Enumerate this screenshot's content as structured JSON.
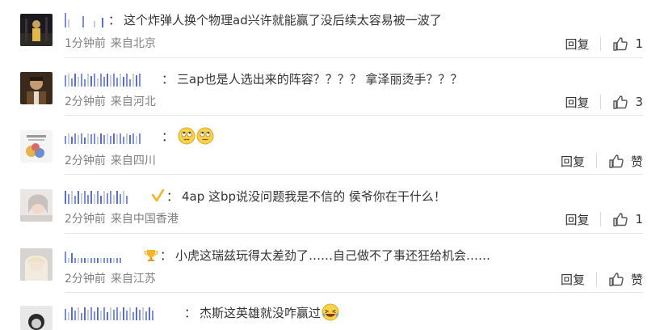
{
  "comments": [
    {
      "text": "这个炸弹人换个物理ad兴许就能赢了没后续太容易被一波了",
      "time": "1分钟前",
      "source": "来自北京",
      "reply_label": "回复",
      "like_label": "1",
      "emojis": []
    },
    {
      "text": "三ap也是人选出来的阵容？？？？ 拿泽丽烫手？？？",
      "time": "2分钟前",
      "source": "来自河北",
      "reply_label": "回复",
      "like_label": "3",
      "emojis": []
    },
    {
      "text": "",
      "time": "2分钟前",
      "source": "来自四川",
      "reply_label": "回复",
      "like_label": "赞",
      "emojis": [
        "rolling-eyes-emoji",
        "rolling-eyes-emoji"
      ]
    },
    {
      "text": "4ap 这bp说没问题我是不信的 侯爷你在干什么！",
      "time": "2分钟前",
      "source": "来自中国香港",
      "reply_label": "回复",
      "like_label": "1",
      "emojis": []
    },
    {
      "text": "小虎这瑞兹玩得太差劲了……自己做不了事还狂给机会……",
      "time": "2分钟前",
      "source": "来自江苏",
      "reply_label": "回复",
      "like_label": "赞",
      "emojis": []
    },
    {
      "text": "杰斯这英雄就没咋赢过",
      "time": "",
      "source": "",
      "reply_label": "",
      "like_label": "",
      "emojis": [
        "laughing-tears-emoji"
      ]
    }
  ],
  "colors": {
    "text": "#333333",
    "meta": "#808080",
    "username": "#7a8fd8",
    "divider": "#e6e6e6"
  },
  "icons": {
    "like": "thumbs-up-icon"
  }
}
